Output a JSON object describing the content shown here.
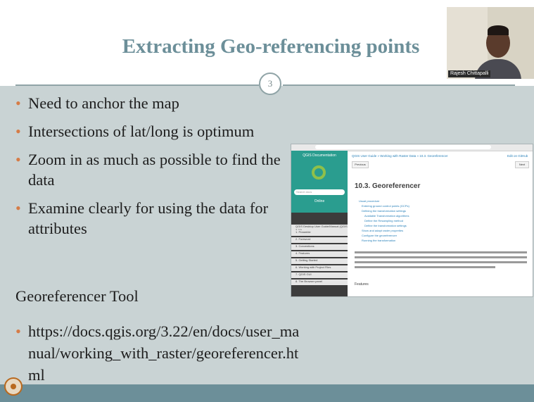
{
  "slide": {
    "title": "Extracting Geo-referencing points",
    "slide_number": "3",
    "bullets": [
      "Need to anchor the map",
      "Intersections of lat/long is optimum",
      "Zoom in as much as possible to find the data",
      "Examine clearly for using the data for attributes"
    ],
    "section_label": "Georeferencer Tool",
    "link_text": "https://docs.qgis.org/3.22/en/docs/user_manual/working_with_raster/georeferencer.html",
    "bullet_glyph": "•"
  },
  "webcam": {
    "caption": "Rajesh Chittapalli"
  },
  "embedded_docs": {
    "sidebar_title": "QGIS Documentation",
    "search_placeholder": "Search docs",
    "sidebar_button": "Online",
    "sidebar_items": [
      "QGIS Desktop User Guide/Manual (QGIS 3.22)",
      "1. Preamble",
      "2. Foreword",
      "3. Conventions",
      "4. Features",
      "5. Getting Started",
      "6. Working with Project Files",
      "7. QGIS GUI",
      "8. The Browser panel"
    ],
    "breadcrumb": "QGIS User Guide » Working with Raster Data » 10.3. Georeferencer",
    "edit_link": "Edit on GitHub",
    "prev_label": "Previous",
    "next_label": "Next",
    "heading": "10.3. Georeferencer",
    "toc": [
      "Usual procedure",
      "Entering ground control points (GCPs)",
      "Defining the transformation settings",
      "Available Transformation algorithms",
      "Define the Resampling method",
      "Define the transformation settings",
      "Show and adapt raster properties",
      "Configure the georeferencer",
      "Running the transformation"
    ],
    "features_heading": "Features"
  }
}
